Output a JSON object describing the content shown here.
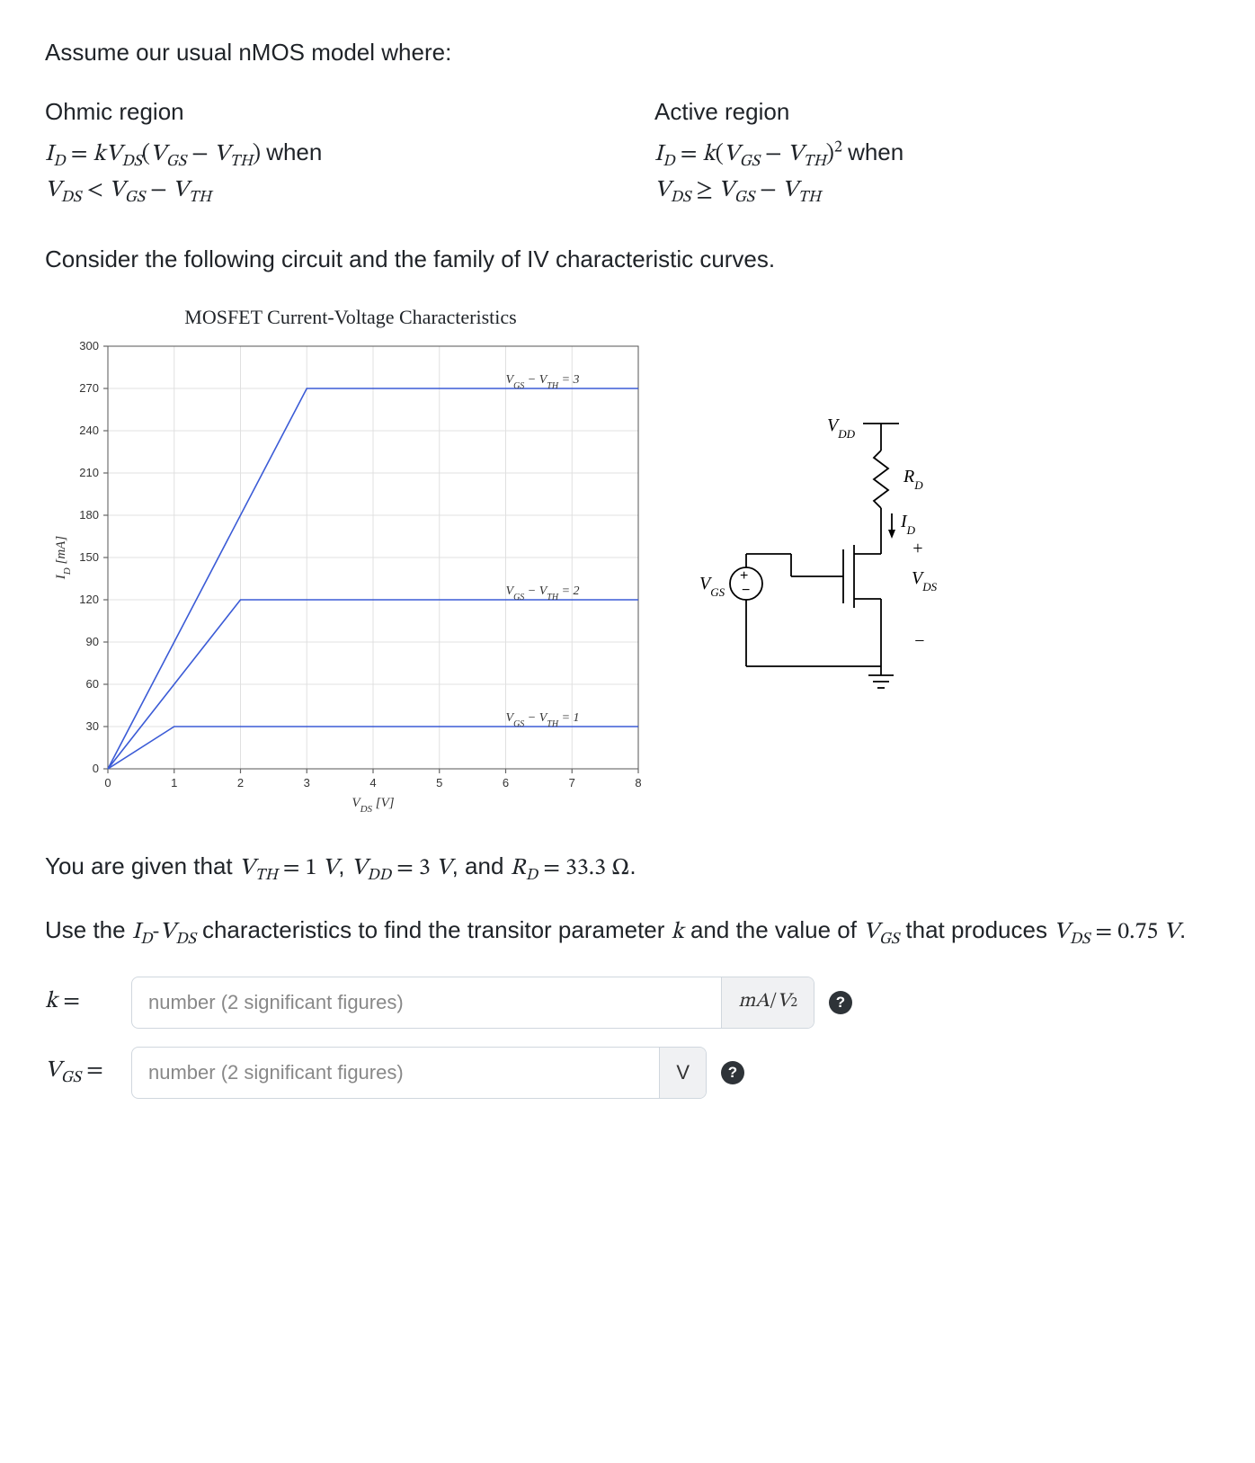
{
  "intro": "Assume our usual nMOS model where:",
  "regions": {
    "ohmic": {
      "title": "Ohmic region",
      "eq_html": "<i>I</i><sub>D</sub> = <i>k</i><i>V</i><sub>DS</sub>(<i>V</i><sub>GS</sub> − <i>V</i><sub>TH</sub>)",
      "when": "when",
      "cond_html": "<i>V</i><sub>DS</sub> &lt; <i>V</i><sub>GS</sub> − <i>V</i><sub>TH</sub>"
    },
    "active": {
      "title": "Active region",
      "eq_html": "<i>I</i><sub>D</sub> = <i>k</i>(<i>V</i><sub>GS</sub> − <i>V</i><sub>TH</sub>)<sup>2</sup>",
      "when": "when",
      "cond_html": "<i>V</i><sub>DS</sub> ≥ <i>V</i><sub>GS</sub> − <i>V</i><sub>TH</sub>"
    }
  },
  "consider": "Consider the following circuit and the family of IV characteristic curves.",
  "chart_data": {
    "type": "line",
    "title": "MOSFET Current-Voltage Characteristics",
    "xlabel": "V_DS [V]",
    "ylabel": "I_D [mA]",
    "xlim": [
      0,
      8
    ],
    "ylim": [
      0,
      300
    ],
    "xticks": [
      0,
      1,
      2,
      3,
      4,
      5,
      6,
      7,
      8
    ],
    "yticks": [
      0,
      30,
      60,
      90,
      120,
      150,
      180,
      210,
      240,
      270,
      300
    ],
    "series": [
      {
        "name": "V_GS - V_TH = 3",
        "points": [
          [
            0,
            0
          ],
          [
            3,
            270
          ],
          [
            8,
            270
          ]
        ]
      },
      {
        "name": "V_GS - V_TH = 2",
        "points": [
          [
            0,
            0
          ],
          [
            2,
            120
          ],
          [
            8,
            120
          ]
        ]
      },
      {
        "name": "V_GS - V_TH = 1",
        "points": [
          [
            0,
            0
          ],
          [
            1,
            30
          ],
          [
            8,
            30
          ]
        ]
      }
    ]
  },
  "circuit": {
    "labels": {
      "vdd": "V_DD",
      "rd": "R_D",
      "id": "I_D",
      "vgs": "V_GS",
      "vds": "V_DS",
      "plus": "+",
      "minus": "−"
    }
  },
  "given_html": "You are given that <span class='math'><i>V</i><sub>TH</sub> = 1 <i>V</i></span>, <span class='math'><i>V</i><sub>DD</sub> = 3 <i>V</i></span>, and <span class='math'><i>R</i><sub>D</sub> = 33.3 Ω</span>.",
  "instr_html": "Use the <span class='math'><i>I</i><sub>D</sub>-<i>V</i><sub>DS</sub></span> characteristics to find the transitor parameter <span class='math'><i>k</i></span> and the value of <span class='math'><i>V</i><sub>GS</sub></span> that produces <span class='math'><i>V</i><sub>DS</sub> = 0.75 <i>V</i></span>.",
  "inputs": {
    "k": {
      "label_html": "<i>k</i> =",
      "placeholder": "number (2 significant figures)",
      "unit_html": "<i>mA</i>/<i>V</i><sup> 2</sup>"
    },
    "vgs": {
      "label_html": "<i>V</i><sub>GS</sub> =",
      "placeholder": "number (2 significant figures)",
      "unit_html": "V"
    }
  },
  "help_glyph": "?"
}
